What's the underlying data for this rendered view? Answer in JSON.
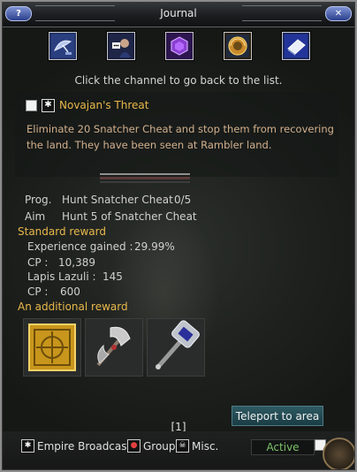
{
  "window": {
    "title": "Journal",
    "left_button_glyph": "?",
    "right_button_glyph": "✕"
  },
  "channels": [
    {
      "name": "Satellite dish",
      "icon": "satellite-dish-icon"
    },
    {
      "name": "Character",
      "icon": "character-portrait-icon"
    },
    {
      "name": "Gem",
      "icon": "purple-gem-icon"
    },
    {
      "name": "Golden orb",
      "icon": "golden-orb-icon"
    },
    {
      "name": "Book",
      "icon": "book-icon"
    }
  ],
  "hint": "Click the channel to go back to the list.",
  "quest": {
    "icon_glyph": "✱",
    "title": "Novajan's Threat",
    "description": "Eliminate 20 Snatcher Cheat and stop them from recovering the land. They have been seen at Rambler land.",
    "progress_fraction": 0.0
  },
  "objectives": {
    "prog_label": "Prog.",
    "prog_text": "Hunt Snatcher Cheat",
    "prog_count": "0/5",
    "aim_label": "Aim",
    "aim_text": "Hunt 5 of Snatcher Cheat"
  },
  "standard_reward": {
    "heading": "Standard reward",
    "exp_label": "Experience gained :",
    "exp_value": "29.99%",
    "cp_label_1": "CP :",
    "cp_value_1": "10,389",
    "lapis_label": "Lapis Lazuli :",
    "lapis_value": "145",
    "cp_label_2": "CP :",
    "cp_value_2": "600"
  },
  "additional_reward": {
    "heading": "An additional reward",
    "items": [
      {
        "icon": "golden-box-icon"
      },
      {
        "icon": "battle-axe-icon"
      },
      {
        "icon": "war-hammer-icon"
      }
    ]
  },
  "pagination": "[1]",
  "teleport_button": "Teleport to area",
  "bottom_bar": {
    "empire_label": "Empire Broadcast",
    "group_label": "Group",
    "misc_label": "Misc.",
    "status": "Active"
  },
  "colors": {
    "accent_gold": "#e8b84a",
    "desc_text": "#d3b08e",
    "active_green": "#7cc26a",
    "teleport_bg": "#2f5a63"
  }
}
